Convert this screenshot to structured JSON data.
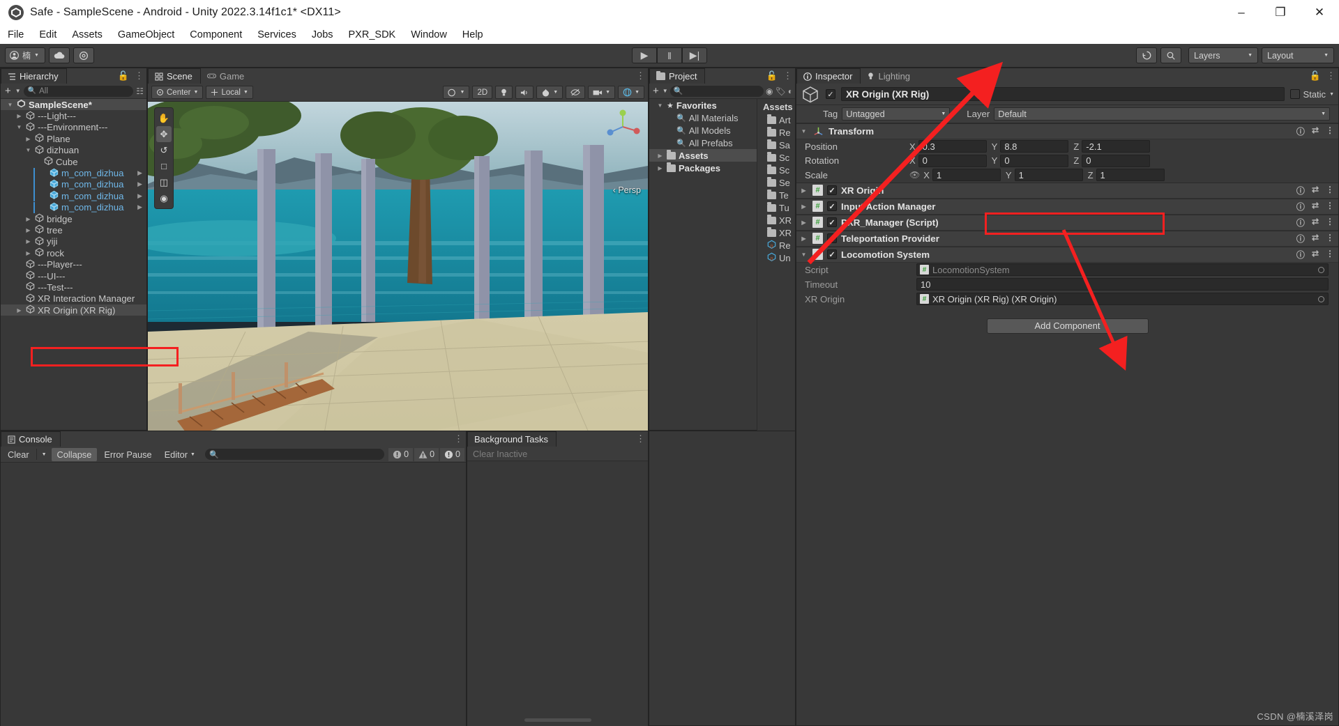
{
  "window": {
    "title": "Safe - SampleScene - Android - Unity 2022.3.14f1c1* <DX11>",
    "minimize": "–",
    "maximize": "❐",
    "close": "✕"
  },
  "menubar": [
    "File",
    "Edit",
    "Assets",
    "GameObject",
    "Component",
    "Services",
    "Jobs",
    "PXR_SDK",
    "Window",
    "Help"
  ],
  "toolbar": {
    "account_label": "楠",
    "cloud_icon": "cloud-icon",
    "settings_icon": "gear-icon",
    "play": "▶",
    "pause": "‖",
    "step": "▶|",
    "history_icon": "undo-history-icon",
    "search_icon": "search-icon",
    "layers": "Layers",
    "layout": "Layout"
  },
  "hierarchy": {
    "tab": "Hierarchy",
    "tab_icon": "hierarchy-icon",
    "add_label": "+",
    "search_placeholder": "All",
    "items": [
      {
        "label": "SampleScene*",
        "depth": 0,
        "arrow": "▼",
        "icon": "unity-scene-icon",
        "bold": true,
        "selected": true
      },
      {
        "label": "---Light---",
        "depth": 1,
        "arrow": "▶",
        "icon": "gameobject-icon"
      },
      {
        "label": "---Environment---",
        "depth": 1,
        "arrow": "▼",
        "icon": "gameobject-icon"
      },
      {
        "label": "Plane",
        "depth": 2,
        "arrow": "▶",
        "icon": "gameobject-icon"
      },
      {
        "label": "dizhuan",
        "depth": 2,
        "arrow": "▼",
        "icon": "gameobject-icon"
      },
      {
        "label": "Cube",
        "depth": 3,
        "arrow": "",
        "icon": "gameobject-icon"
      },
      {
        "label": "m_com_dizhua",
        "depth": 3,
        "arrow": "",
        "icon": "prefab-icon",
        "prefab": true,
        "overflow": true
      },
      {
        "label": "m_com_dizhua",
        "depth": 3,
        "arrow": "",
        "icon": "prefab-icon",
        "prefab": true,
        "overflow": true
      },
      {
        "label": "m_com_dizhua",
        "depth": 3,
        "arrow": "",
        "icon": "prefab-icon",
        "prefab": true,
        "overflow": true
      },
      {
        "label": "m_com_dizhua",
        "depth": 3,
        "arrow": "",
        "icon": "prefab-icon",
        "prefab": true,
        "overflow": true
      },
      {
        "label": "bridge",
        "depth": 2,
        "arrow": "▶",
        "icon": "gameobject-icon"
      },
      {
        "label": "tree",
        "depth": 2,
        "arrow": "▶",
        "icon": "gameobject-icon"
      },
      {
        "label": "yiji",
        "depth": 2,
        "arrow": "▶",
        "icon": "gameobject-icon"
      },
      {
        "label": "rock",
        "depth": 2,
        "arrow": "▶",
        "icon": "gameobject-icon"
      },
      {
        "label": "---Player---",
        "depth": 1,
        "arrow": "",
        "icon": "gameobject-icon"
      },
      {
        "label": "---UI---",
        "depth": 1,
        "arrow": "",
        "icon": "gameobject-icon"
      },
      {
        "label": "---Test---",
        "depth": 1,
        "arrow": "",
        "icon": "gameobject-icon"
      },
      {
        "label": "XR Interaction Manager",
        "depth": 1,
        "arrow": "",
        "icon": "gameobject-icon"
      },
      {
        "label": "XR Origin (XR Rig)",
        "depth": 1,
        "arrow": "▶",
        "icon": "gameobject-icon",
        "highlighted": true
      }
    ]
  },
  "scene": {
    "tabs": [
      {
        "label": "Scene",
        "icon": "scene-icon",
        "active": true
      },
      {
        "label": "Game",
        "icon": "game-icon",
        "active": false
      }
    ],
    "pivot_mode": "Center",
    "pivot_rotation": "Local",
    "toggle_2d": "2D",
    "persp_label": "‹ Persp",
    "gizmo_tools": [
      "hand-tool-icon",
      "move-tool-icon",
      "rotate-tool-icon",
      "scale-tool-icon",
      "rect-tool-icon",
      "transform-tool-icon"
    ]
  },
  "project": {
    "tab": "Project",
    "tab_icon": "folder-icon",
    "search_placeholder": "",
    "tree": [
      {
        "label": "Favorites",
        "depth": 0,
        "arrow": "▼",
        "icon": "star-icon",
        "bold": true
      },
      {
        "label": "All Materials",
        "depth": 1,
        "arrow": "",
        "icon": "search-icon"
      },
      {
        "label": "All Models",
        "depth": 1,
        "arrow": "",
        "icon": "search-icon"
      },
      {
        "label": "All Prefabs",
        "depth": 1,
        "arrow": "",
        "icon": "search-icon"
      },
      {
        "label": "Assets",
        "depth": 0,
        "arrow": "▶",
        "icon": "folder-icon",
        "bold": true,
        "selected": true
      },
      {
        "label": "Packages",
        "depth": 0,
        "arrow": "▶",
        "icon": "folder-icon",
        "bold": true
      }
    ],
    "content_header": "Assets",
    "content": [
      {
        "label": "Art",
        "icon": "folder-icon"
      },
      {
        "label": "Re",
        "icon": "folder-icon"
      },
      {
        "label": "Sa",
        "icon": "folder-icon"
      },
      {
        "label": "Sc",
        "icon": "folder-icon"
      },
      {
        "label": "Sc",
        "icon": "folder-icon"
      },
      {
        "label": "Se",
        "icon": "folder-icon"
      },
      {
        "label": "Te",
        "icon": "folder-icon"
      },
      {
        "label": "Tu",
        "icon": "folder-icon"
      },
      {
        "label": "XR",
        "icon": "folder-icon"
      },
      {
        "label": "XR",
        "icon": "folder-icon"
      },
      {
        "label": "Re",
        "icon": "prefab-asset-icon"
      },
      {
        "label": "Un",
        "icon": "prefab-asset-icon"
      }
    ]
  },
  "inspector": {
    "tabs": [
      {
        "label": "Inspector",
        "icon": "info-icon",
        "active": true
      },
      {
        "label": "Lighting",
        "icon": "light-icon",
        "active": false
      }
    ],
    "object_name": "XR Origin (XR Rig)",
    "enabled": true,
    "static_label": "Static",
    "tag_label": "Tag",
    "tag_value": "Untagged",
    "layer_label": "Layer",
    "layer_value": "Default",
    "transform": {
      "title": "Transform",
      "rows": [
        {
          "label": "Position",
          "x": "0.3",
          "y": "8.8",
          "z": "-2.1"
        },
        {
          "label": "Rotation",
          "x": "0",
          "y": "0",
          "z": "0"
        },
        {
          "label": "Scale",
          "x": "1",
          "y": "1",
          "z": "1",
          "lock_icon": "scale-lock-icon"
        }
      ],
      "axes": [
        "X",
        "Y",
        "Z"
      ]
    },
    "components": [
      {
        "name": "XR Origin",
        "enabled": true,
        "expanded": false,
        "highlighted": true
      },
      {
        "name": "Input Action Manager",
        "enabled": true,
        "expanded": false
      },
      {
        "name": "PXR_Manager (Script)",
        "enabled": true,
        "expanded": false
      },
      {
        "name": "Teleportation Provider",
        "enabled": true,
        "expanded": false
      },
      {
        "name": "Locomotion System",
        "enabled": true,
        "expanded": true
      }
    ],
    "locomotion_fields": [
      {
        "label": "Script",
        "type": "object",
        "value": "LocomotionSystem",
        "disabled": true
      },
      {
        "label": "Timeout",
        "type": "text",
        "value": "10"
      },
      {
        "label": "XR Origin",
        "type": "object",
        "value": "XR Origin (XR Rig) (XR Origin)"
      }
    ],
    "add_component": "Add Component"
  },
  "console": {
    "tab": "Console",
    "tab_icon": "console-icon",
    "clear": "Clear",
    "collapse": "Collapse",
    "error_pause": "Error Pause",
    "editor": "Editor",
    "search_placeholder": "",
    "counts": [
      {
        "icon": "error-icon",
        "value": "0"
      },
      {
        "icon": "warning-icon",
        "value": "0"
      },
      {
        "icon": "info-icon",
        "value": "0"
      }
    ]
  },
  "background_tasks": {
    "tab": "Background Tasks",
    "clear_inactive": "Clear Inactive"
  },
  "watermark": "CSDN @楠溪泽岗",
  "annotations": {
    "highlight_color": "#f42020",
    "boxes": [
      "hierarchy-xr-origin",
      "inspector-xr-origin-component"
    ],
    "arrows": [
      "project-to-inspector-tab",
      "component-to-xr-origin-field"
    ]
  }
}
